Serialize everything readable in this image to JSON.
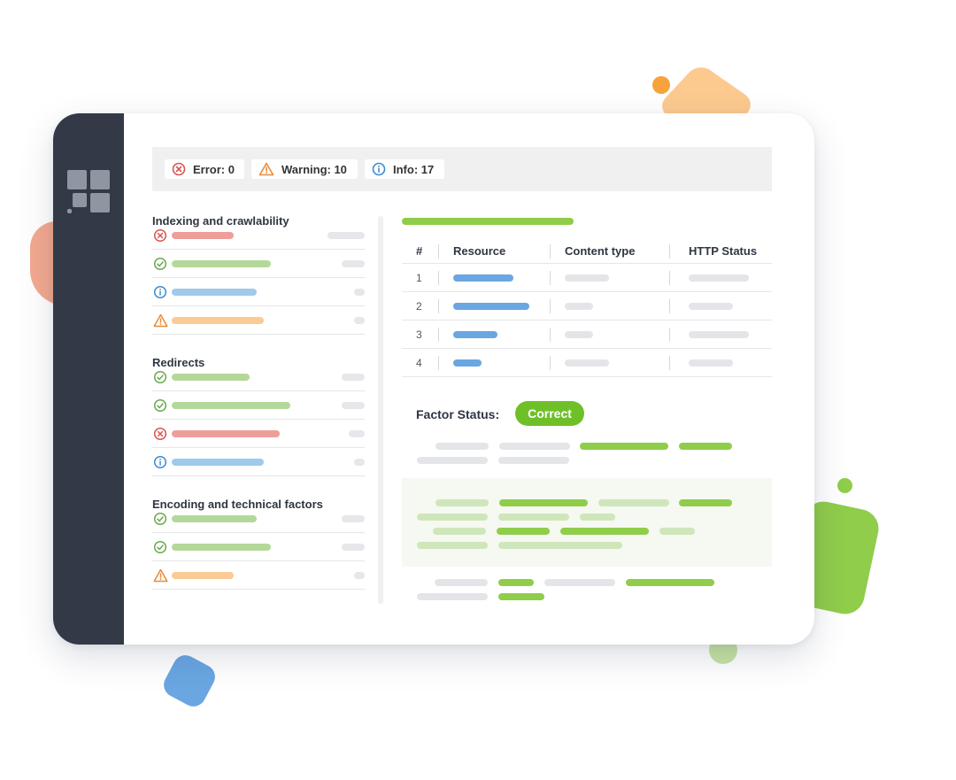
{
  "colors": {
    "sidebar": "#333947",
    "accent_green": "#6fc028",
    "error": "#d9534f",
    "warning": "#e98a3a",
    "info": "#3a8ad2",
    "ok": "#6aa84f"
  },
  "status_bar": {
    "error": {
      "label": "Error: 0",
      "icon": "error-circle-icon"
    },
    "warning": {
      "label": "Warning: 10",
      "icon": "warning-triangle-icon"
    },
    "info": {
      "label": "Info: 17",
      "icon": "info-circle-icon"
    }
  },
  "sections": [
    {
      "title": "Indexing and crawlability",
      "items": [
        {
          "status": "error"
        },
        {
          "status": "ok"
        },
        {
          "status": "info"
        },
        {
          "status": "warning"
        }
      ]
    },
    {
      "title": "Redirects",
      "items": [
        {
          "status": "ok"
        },
        {
          "status": "ok"
        },
        {
          "status": "error"
        },
        {
          "status": "info"
        }
      ]
    },
    {
      "title": "Encoding and technical factors",
      "items": [
        {
          "status": "ok"
        },
        {
          "status": "ok"
        },
        {
          "status": "warning"
        }
      ]
    }
  ],
  "table": {
    "headers": [
      "#",
      "Resource",
      "Content type",
      "HTTP Status"
    ],
    "rows": [
      "1",
      "2",
      "3",
      "4"
    ]
  },
  "factor": {
    "label": "Factor Status:",
    "value": "Correct"
  }
}
